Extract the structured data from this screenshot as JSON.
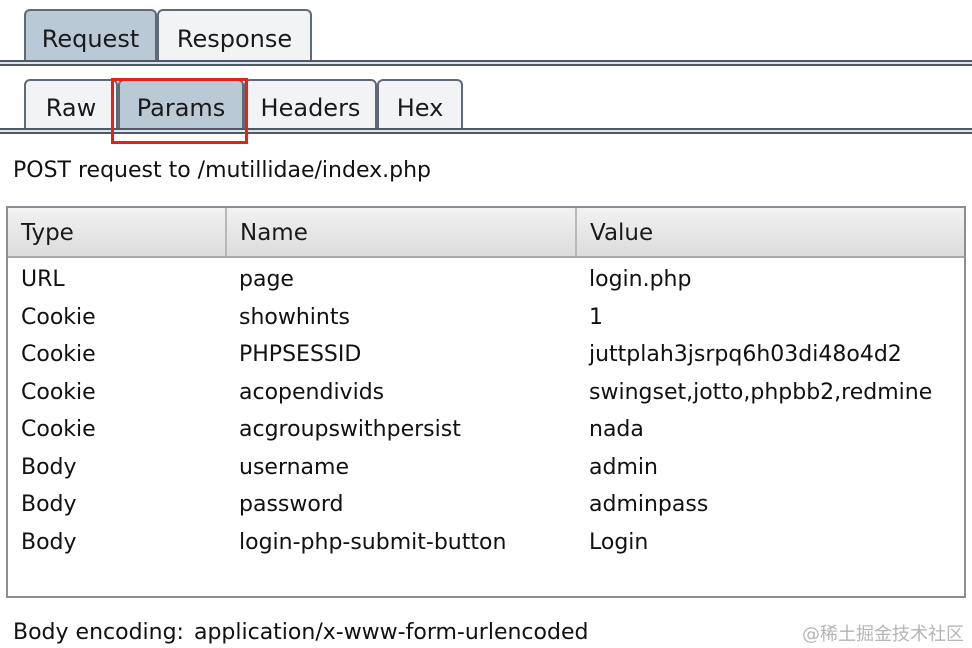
{
  "top_tabs": [
    {
      "label": "Request",
      "active": true
    },
    {
      "label": "Response",
      "active": false
    }
  ],
  "sub_tabs": [
    {
      "label": "Raw",
      "active": false
    },
    {
      "label": "Params",
      "active": true
    },
    {
      "label": "Headers",
      "active": false
    },
    {
      "label": "Hex",
      "active": false
    }
  ],
  "request_line": "POST request to /mutillidae/index.php",
  "table": {
    "columns": [
      "Type",
      "Name",
      "Value"
    ],
    "rows": [
      [
        "URL",
        "page",
        "login.php"
      ],
      [
        "Cookie",
        "showhints",
        "1"
      ],
      [
        "Cookie",
        "PHPSESSID",
        "juttplah3jsrpq6h03di48o4d2"
      ],
      [
        "Cookie",
        "acopendivids",
        "swingset,jotto,phpbb2,redmine"
      ],
      [
        "Cookie",
        "acgroupswithpersist",
        "nada"
      ],
      [
        "Body",
        "username",
        "admin"
      ],
      [
        "Body",
        "password",
        "adminpass"
      ],
      [
        "Body",
        "login-php-submit-button",
        "Login"
      ]
    ]
  },
  "footer": {
    "encoding_label": "Body encoding:",
    "encoding_value": "application/x-www-form-urlencoded"
  },
  "watermark": "@稀土掘金技术社区",
  "colors": {
    "highlight": "#e2231a",
    "active_tab": "#b9c9d6"
  }
}
